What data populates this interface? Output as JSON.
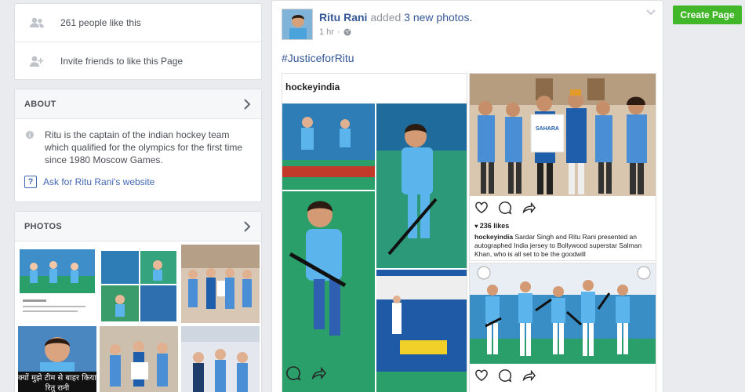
{
  "likes": {
    "people_like": "261 people like this",
    "invite": "Invite friends to like this Page"
  },
  "about": {
    "header": "ABOUT",
    "description": "Ritu is the captain of the indian hockey team which qualified for the olympics for the first time since 1980 Moscow Games.",
    "website_link": "Ask for Ritu Rani's website"
  },
  "photos": {
    "header": "PHOTOS",
    "thumb_caption_hindi": "क्यों मुझे टीम से बाहर किया रितु रानी"
  },
  "post": {
    "author": "Ritu Rani",
    "verb": "added",
    "photos_link": "3 new photos.",
    "time": "1 hr",
    "separator": "·",
    "hashtag": "#JusticeforRitu",
    "image_a": {
      "account": "hockeyindia"
    },
    "image_b": {
      "likes": "236 likes",
      "caption_account": "hockeyindia",
      "caption": "Sardar Singh and Ritu Rani presented an autographed India jersey to Bollywood superstar Salman Khan, who is all set to be the goodwill",
      "jersey_text": "SAHARA"
    }
  },
  "actions": {
    "create_page": "Create Page"
  },
  "colors": {
    "link": "#365899",
    "button_green": "#42b72a",
    "page_bg": "#e9ebee",
    "jersey_blue": "#4ba3dc"
  }
}
